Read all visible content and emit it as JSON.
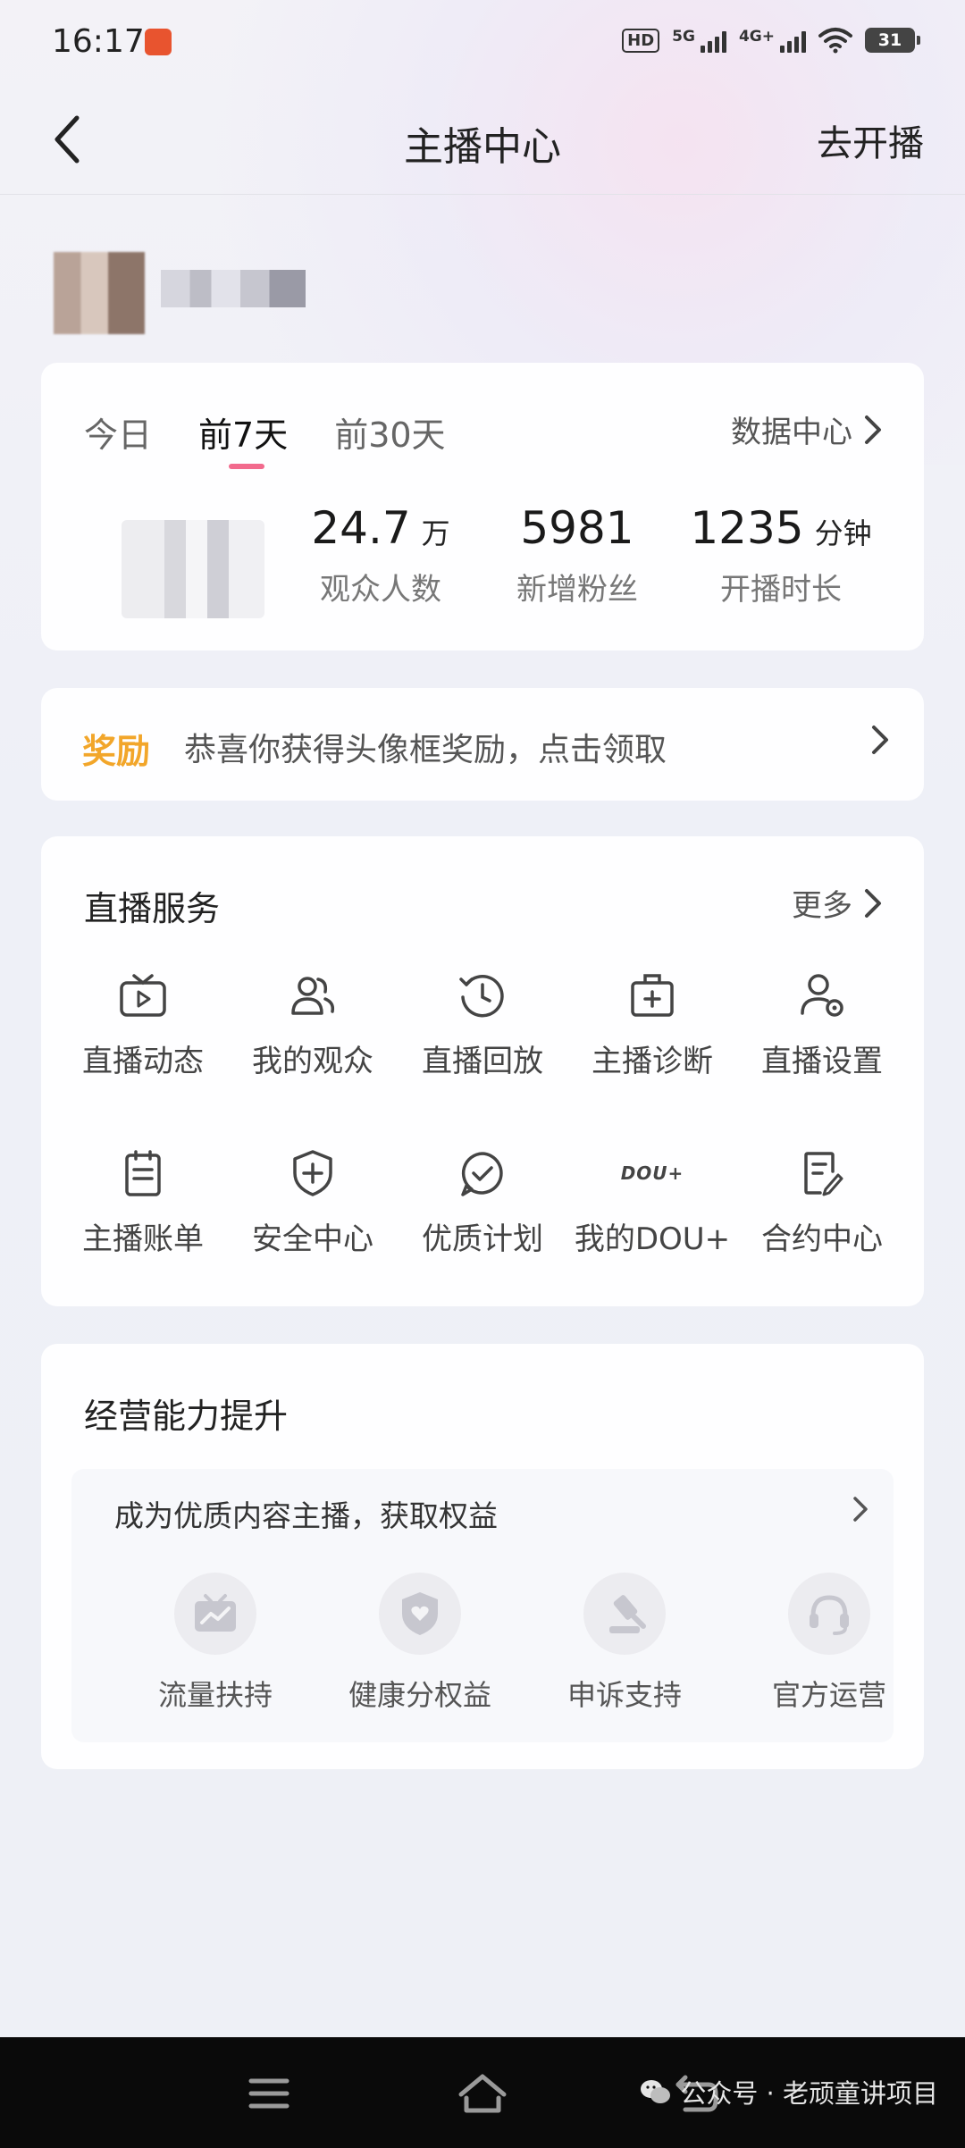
{
  "status_bar": {
    "time": "16:17",
    "hd_label": "HD",
    "sig1_label": "5G",
    "sig2_label": "4G+",
    "battery": "31"
  },
  "nav": {
    "title": "主播中心",
    "action": "去开播"
  },
  "stats": {
    "tabs": [
      "今日",
      "前7天",
      "前30天"
    ],
    "active_tab": "前7天",
    "data_center_label": "数据中心",
    "items": [
      {
        "value": "24.7",
        "unit": "万",
        "label": "观众人数"
      },
      {
        "value": "5981",
        "unit": "",
        "label": "新增粉丝"
      },
      {
        "value": "1235",
        "unit": "分钟",
        "label": "开播时长"
      }
    ]
  },
  "reward": {
    "tag": "奖励",
    "text": "恭喜你获得头像框奖励，点击领取"
  },
  "live_services": {
    "title": "直播服务",
    "more_label": "更多",
    "items": [
      {
        "label": "直播动态",
        "icon": "tv-play-icon"
      },
      {
        "label": "我的观众",
        "icon": "users-icon"
      },
      {
        "label": "直播回放",
        "icon": "replay-clock-icon"
      },
      {
        "label": "主播诊断",
        "icon": "medical-kit-icon"
      },
      {
        "label": "直播设置",
        "icon": "user-settings-icon"
      },
      {
        "label": "主播账单",
        "icon": "bill-icon"
      },
      {
        "label": "安全中心",
        "icon": "shield-plus-icon"
      },
      {
        "label": "优质计划",
        "icon": "check-bubble-icon"
      },
      {
        "label": "我的DOU+",
        "icon": "dou-logo-icon",
        "icon_text": "DOU+"
      },
      {
        "label": "合约中心",
        "icon": "contract-edit-icon"
      }
    ]
  },
  "business": {
    "title": "经营能力提升",
    "promo": "成为优质内容主播，获取权益",
    "items": [
      {
        "label": "流量扶持",
        "icon": "traffic-chart-icon"
      },
      {
        "label": "健康分权益",
        "icon": "shield-heart-icon"
      },
      {
        "label": "申诉支持",
        "icon": "gavel-icon"
      },
      {
        "label": "官方运营",
        "icon": "headset-icon"
      }
    ]
  },
  "system_nav": {
    "watermark": "公众号 · 老顽童讲项目"
  },
  "colors": {
    "reward_tag": "#f2a62a",
    "active_tab_underline": "#f26a8d"
  }
}
